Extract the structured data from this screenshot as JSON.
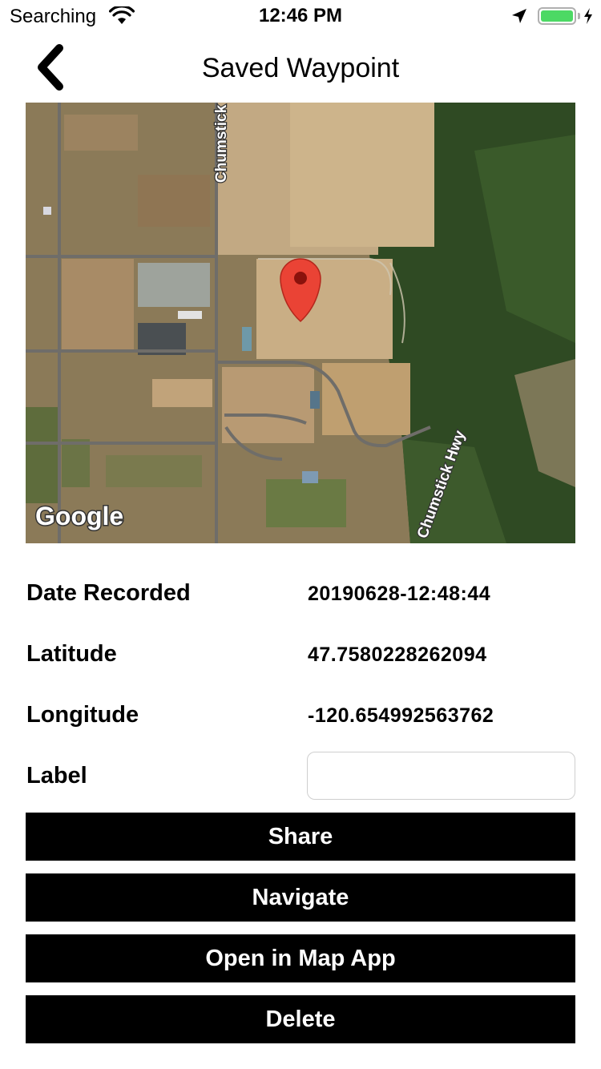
{
  "status_bar": {
    "carrier": "Searching",
    "time": "12:46 PM",
    "icons": [
      "wifi-icon",
      "location-arrow-icon",
      "battery-icon",
      "charging-bolt-icon"
    ],
    "battery_color": "#4cd964"
  },
  "nav": {
    "title": "Saved Waypoint",
    "back_icon": "chevron-left-icon"
  },
  "map": {
    "road_labels": [
      "Chumstick Hwy",
      "Chumstick Hwy"
    ],
    "attribution": "Google",
    "marker_color": "#ea4335"
  },
  "info": {
    "date": {
      "label": "Date Recorded",
      "value": "20190628-12:48:44"
    },
    "latitude": {
      "label": "Latitude",
      "value": "47.7580228262094"
    },
    "longitude": {
      "label": "Longitude",
      "value": "-120.654992563762"
    },
    "label_field": {
      "label": "Label",
      "value": "",
      "placeholder": ""
    }
  },
  "actions": {
    "share": "Share",
    "navigate": "Navigate",
    "open_map": "Open in Map App",
    "delete": "Delete"
  }
}
